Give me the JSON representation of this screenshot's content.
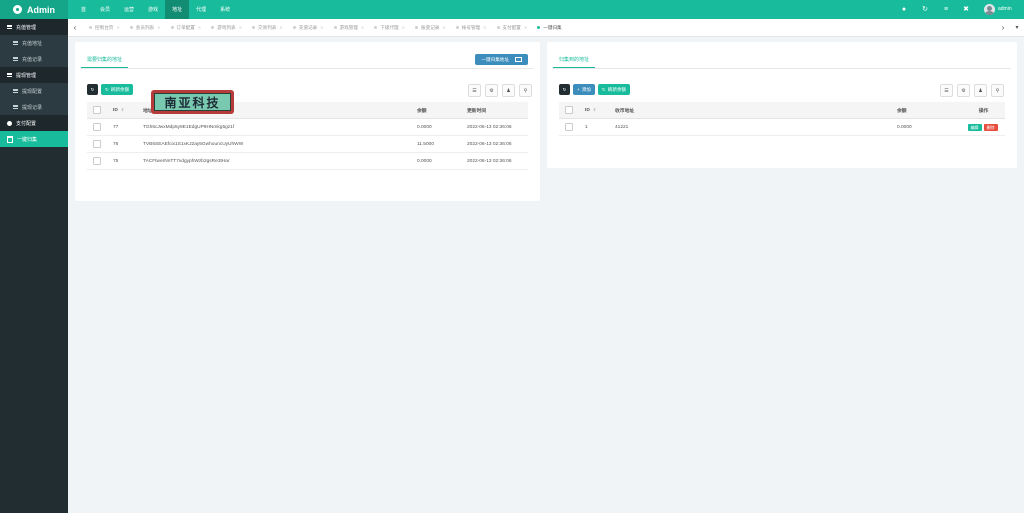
{
  "app": {
    "brand": "Admin",
    "username": "admin"
  },
  "colors": {
    "accent": "#18bc9c",
    "sidebar": "#222d32",
    "primary": "#3c8dbc",
    "danger": "#e74c3c"
  },
  "topnav": {
    "items": [
      {
        "label": "首"
      },
      {
        "label": "会员"
      },
      {
        "label": "运营"
      },
      {
        "label": "游戏"
      },
      {
        "label": "地址"
      },
      {
        "label": "代理"
      },
      {
        "label": "系统"
      }
    ],
    "active_index": 4
  },
  "top_icons": [
    "circle-icon",
    "refresh-icon",
    "menu-icon",
    "fullscreen-icon"
  ],
  "sidebar": {
    "items": [
      {
        "label": "充值管理",
        "type": "group",
        "icon": "list-icon"
      },
      {
        "label": "充值地址",
        "type": "sub",
        "icon": "list-icon"
      },
      {
        "label": "充值记录",
        "type": "sub",
        "icon": "list-icon"
      },
      {
        "label": "提现管理",
        "type": "group",
        "icon": "list-icon"
      },
      {
        "label": "提现配置",
        "type": "sub",
        "icon": "list-icon"
      },
      {
        "label": "提现记录",
        "type": "sub",
        "icon": "list-icon"
      },
      {
        "label": "支付配置",
        "type": "group",
        "icon": "dot-icon"
      },
      {
        "label": "一键归集",
        "type": "active",
        "icon": "calendar-icon"
      }
    ]
  },
  "tabs": [
    {
      "label": "控制台页"
    },
    {
      "label": "会员列表"
    },
    {
      "label": "订单配置"
    },
    {
      "label": "游戏列表"
    },
    {
      "label": "交易列表"
    },
    {
      "label": "充值记录"
    },
    {
      "label": "游戏管理"
    },
    {
      "label": "下级代理"
    },
    {
      "label": "账变记录"
    },
    {
      "label": "帐号管理"
    },
    {
      "label": "支付配置"
    },
    {
      "label": "一键归集",
      "active": true
    }
  ],
  "left_panel": {
    "tab_label": "需要归集的地址",
    "action_button": "一键归集地址",
    "refresh_balance_label": "刷新余额",
    "columns": {
      "id": "ID",
      "address": "地址",
      "balance": "余额",
      "updated": "更新时间"
    },
    "rows": [
      {
        "id": "77",
        "address": "TGh6cJwxMdp5y9E1EdgUP9HNmkg5gz1f",
        "balance": "0.0000",
        "updated": "2022-06-13 02:36:06"
      },
      {
        "id": "76",
        "address": "TVB6SEAEfcix1S1xKJ2ay5GwhouncUyUhWW",
        "balance": "11.5000",
        "updated": "2022-06-13 02:36:06"
      },
      {
        "id": "75",
        "address": "TACFtwerNnTT7vdgyphWzb2gsRe3tHar",
        "balance": "0.0000",
        "updated": "2022-06-13 02:36:06"
      }
    ]
  },
  "right_panel": {
    "tab_label": "归集到的地址",
    "add_label": "添加",
    "refresh_balance_label": "刷新余额",
    "columns": {
      "id": "ID",
      "address": "收币地址",
      "balance": "余额",
      "ops": "操作"
    },
    "rows": [
      {
        "id": "1",
        "address": "41221",
        "balance": "0.0000",
        "edit": "编辑",
        "delete": "删除"
      }
    ]
  },
  "watermark": {
    "text": "南亚科技"
  }
}
